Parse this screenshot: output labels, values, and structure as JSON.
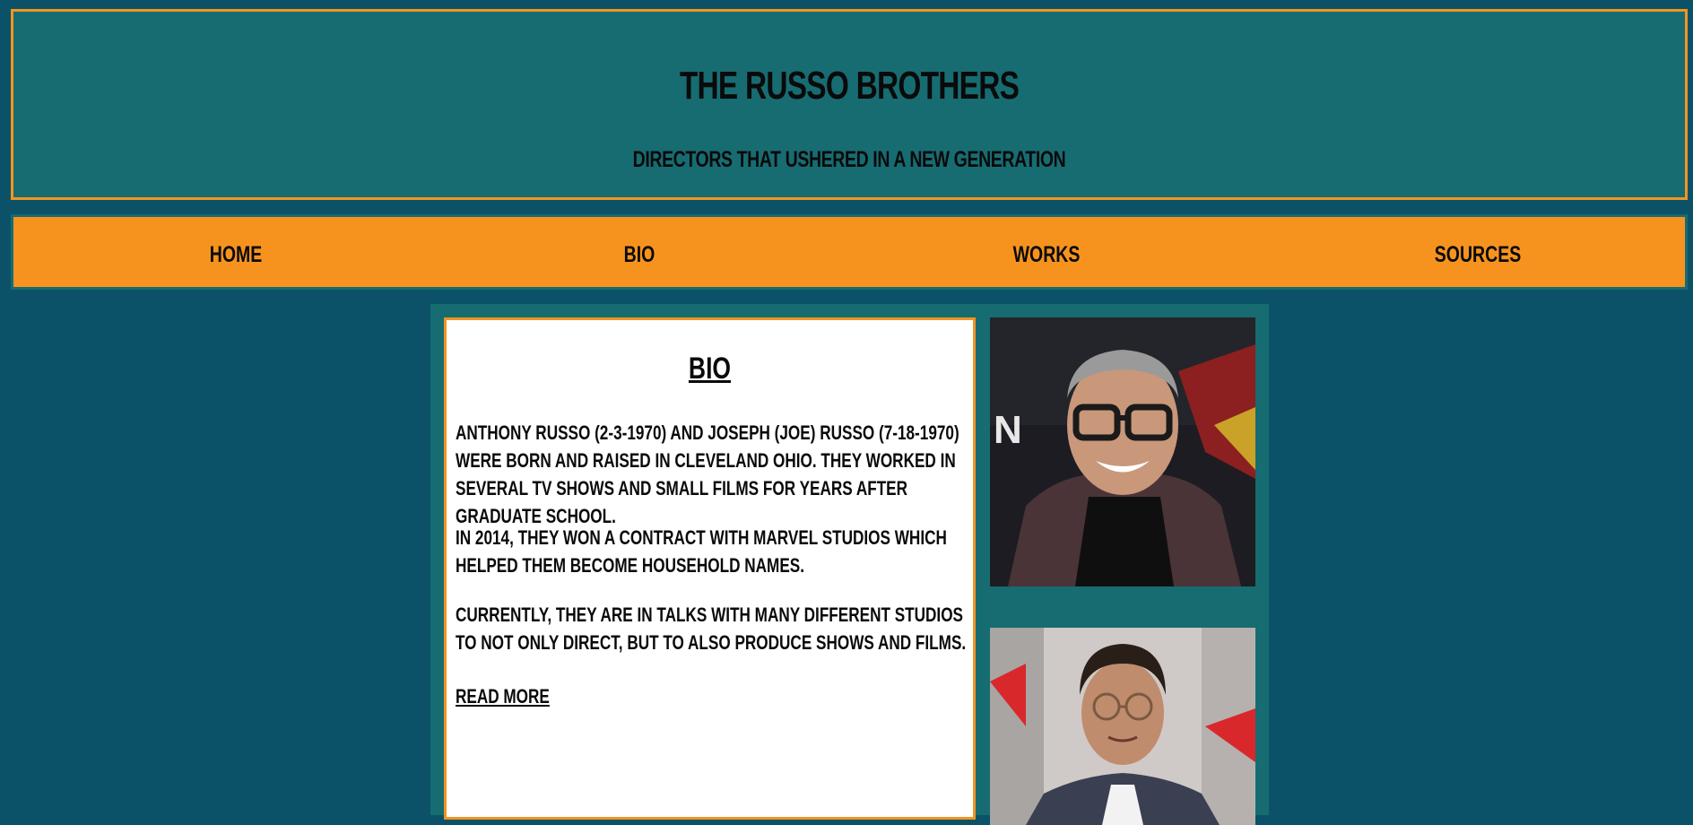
{
  "header": {
    "title": "THE RUSSO BROTHERS",
    "subtitle": "DIRECTORS THAT USHERED IN A NEW GENERATION"
  },
  "nav": {
    "items": [
      {
        "label": "HOME"
      },
      {
        "label": "BIO"
      },
      {
        "label": "WORKS"
      },
      {
        "label": "SOURCES"
      }
    ]
  },
  "bio": {
    "title": "BIO",
    "paragraphs": [
      "ANTHONY RUSSO (2-3-1970) AND JOSEPH (JOE) RUSSO (7-18-1970) WERE BORN AND RAISED IN CLEVELAND OHIO. THEY WORKED IN SEVERAL TV SHOWS AND SMALL FILMS FOR YEARS AFTER GRADUATE SCHOOL.",
      "IN 2014, THEY WON A CONTRACT WITH MARVEL STUDIOS WHICH HELPED THEM BECOME HOUSEHOLD NAMES.",
      "CURRENTLY, THEY ARE IN TALKS WITH MANY DIFFERENT STUDIOS TO NOT ONLY DIRECT, BUT TO ALSO PRODUCE SHOWS AND FILMS."
    ],
    "read_more": "READ MORE"
  },
  "colors": {
    "page_bg": "#0b5268",
    "header_bg": "#176c72",
    "accent_orange": "#f6931f",
    "card_bg": "#ffffff"
  }
}
